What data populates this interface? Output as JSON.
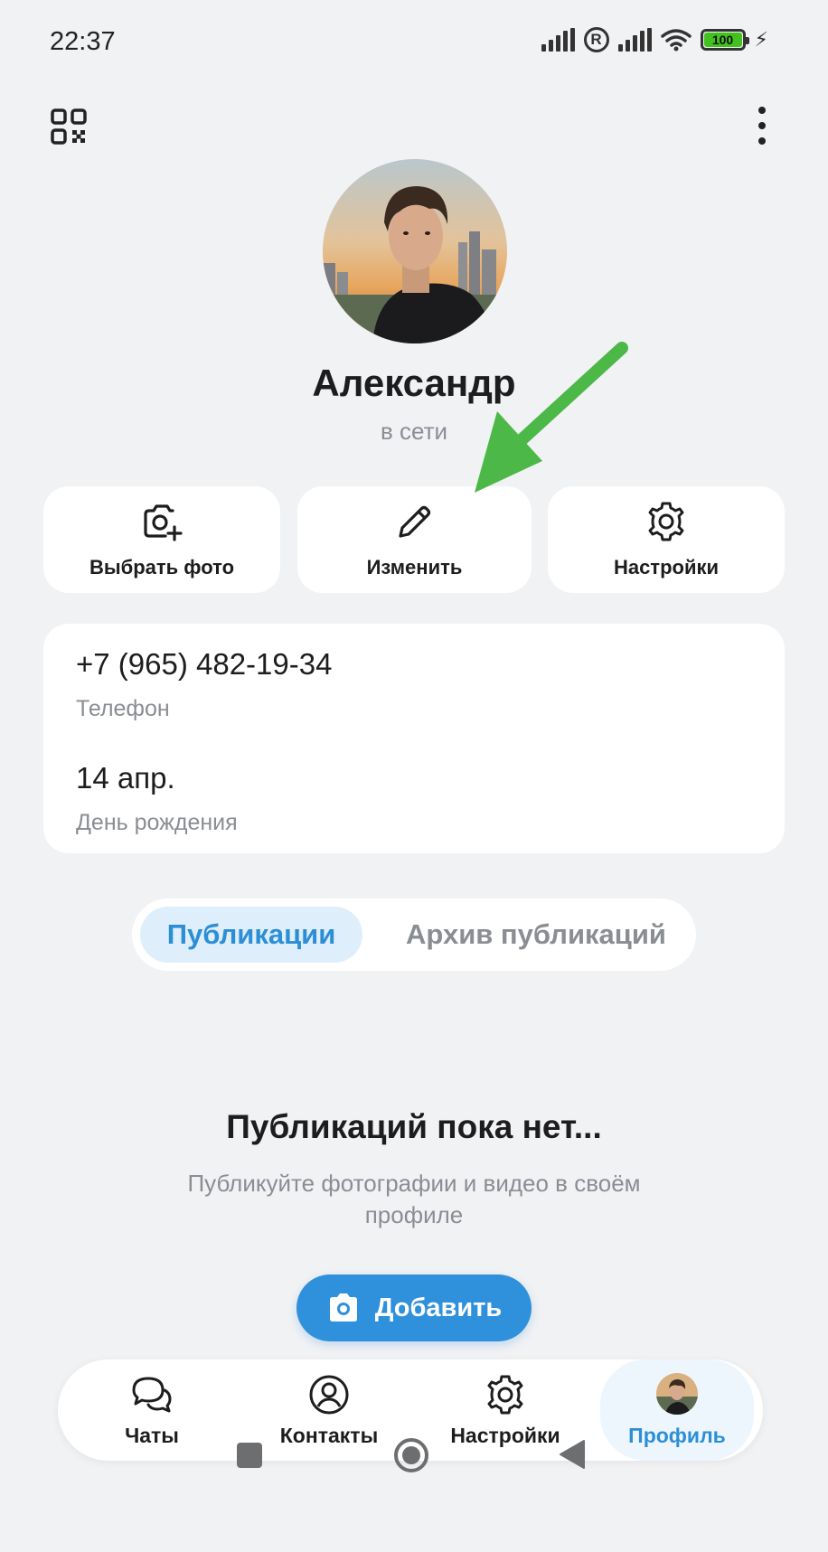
{
  "status_bar": {
    "time": "22:37",
    "battery": "100"
  },
  "profile": {
    "name": "Александр",
    "status": "в сети"
  },
  "actions": [
    {
      "label": "Выбрать фото",
      "icon": "camera-plus-icon"
    },
    {
      "label": "Изменить",
      "icon": "pencil-icon"
    },
    {
      "label": "Настройки",
      "icon": "gear-icon"
    }
  ],
  "info": {
    "phone_value": "+7 (965) 482-19-34",
    "phone_caption": "Телефон",
    "birthday_value": "14 апр.",
    "birthday_caption": "День рождения"
  },
  "tabs": [
    {
      "label": "Публикации",
      "active": true
    },
    {
      "label": "Архив публикаций",
      "active": false
    }
  ],
  "empty_state": {
    "title": "Публикаций пока нет...",
    "description": "Публикуйте фотографии и видео в своём профиле",
    "add_button": "Добавить"
  },
  "bottom_nav": [
    {
      "label": "Чаты",
      "icon": "chat-bubbles-icon"
    },
    {
      "label": "Контакты",
      "icon": "contact-icon"
    },
    {
      "label": "Настройки",
      "icon": "gear-icon"
    },
    {
      "label": "Профиль",
      "icon": "profile-avatar",
      "active": true
    }
  ],
  "colors": {
    "accent": "#2f90db",
    "arrow": "#4cb848",
    "background": "#f1f2f4"
  }
}
